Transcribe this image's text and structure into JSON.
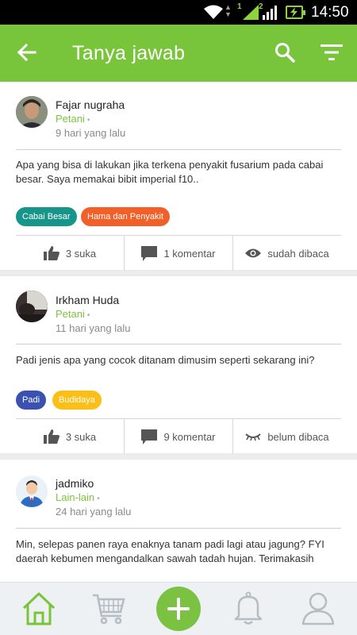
{
  "status_bar": {
    "time": "14:50",
    "sim1": "1",
    "sim2": "2"
  },
  "header": {
    "title": "Tanya jawab"
  },
  "posts": [
    {
      "author": "Fajar nugraha",
      "role": "Petani",
      "time": "9 hari yang lalu",
      "text": "Apa yang bisa di lakukan jika terkena penyakit fusarium pada cabai besar. Saya memakai bibit imperial f10..",
      "tags": [
        {
          "label": "Cabai Besar",
          "color": "#17958b"
        },
        {
          "label": "Hama dan Penyakit",
          "color": "#f2602a"
        }
      ],
      "likes": "3 suka",
      "comments": "1 komentar",
      "read_status": "sudah dibaca"
    },
    {
      "author": "Irkham Huda",
      "role": "Petani",
      "time": "11 hari yang lalu",
      "text": "Padi jenis apa yang cocok ditanam dimusim seperti sekarang ini?",
      "tags": [
        {
          "label": "Padi",
          "color": "#3a51b0"
        },
        {
          "label": "Budidaya",
          "color": "#fbbf18"
        }
      ],
      "likes": "3 suka",
      "comments": "9 komentar",
      "read_status": "belum dibaca"
    },
    {
      "author": "jadmiko",
      "role": "Lain-lain",
      "time": "24 hari yang lalu",
      "text": "Min, selepas panen raya enaknya tanam padi lagi atau jagung? FYI daerah kebumen mengandalkan sawah tadah hujan. Terimakasih"
    }
  ],
  "colors": {
    "accent": "#78c43a",
    "icon_gray": "#555555",
    "nav_icon": "#b4bcc4"
  }
}
